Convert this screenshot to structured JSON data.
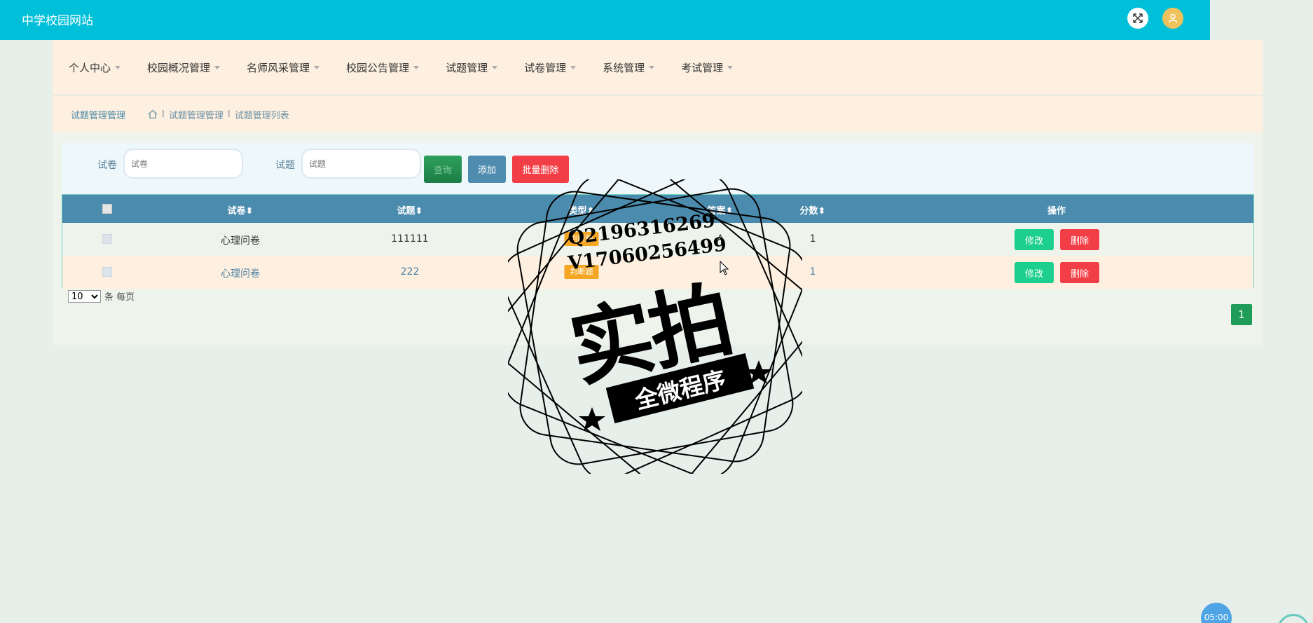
{
  "header": {
    "site_title": "中学校园网站",
    "colors": {
      "bar": "#00bfd9",
      "avatar": "#f0c25b"
    },
    "icons": [
      "fullscreen-icon",
      "user-icon"
    ]
  },
  "nav": {
    "items": [
      {
        "label": "个人中心"
      },
      {
        "label": "校园概况管理"
      },
      {
        "label": "名师风采管理"
      },
      {
        "label": "校园公告管理"
      },
      {
        "label": "试题管理"
      },
      {
        "label": "试卷管理"
      },
      {
        "label": "系统管理"
      },
      {
        "label": "考试管理"
      }
    ]
  },
  "breadcrumb": {
    "title": "试题管理管理",
    "path": [
      "试题管理管理",
      "试题管理列表"
    ],
    "separator": "I"
  },
  "search": {
    "paper_label": "试卷",
    "paper_placeholder": "试卷",
    "question_label": "试题",
    "question_placeholder": "试题",
    "search_button": "查询",
    "add_button": "添加",
    "batch_delete_button": "批量删除"
  },
  "table": {
    "columns": [
      "试卷",
      "试题",
      "类型",
      "答案",
      "分数",
      "操作"
    ],
    "rows": [
      {
        "paper": "心理问卷",
        "question": "111111",
        "type": "判断题",
        "answer": "A",
        "score": "1",
        "edit": "修改",
        "delete": "删除"
      },
      {
        "paper": "心理问卷",
        "question": "222",
        "type": "判断题",
        "answer": "",
        "score": "1",
        "edit": "修改",
        "delete": "删除"
      }
    ]
  },
  "pager": {
    "page_size": "10",
    "page_size_suffix": "条 每页",
    "current_page": "1"
  },
  "watermark": {
    "line1": "Q2196316269",
    "line2": "V17060256499",
    "big": "实拍",
    "ribbon": "全微程序"
  },
  "timer": "05:00"
}
